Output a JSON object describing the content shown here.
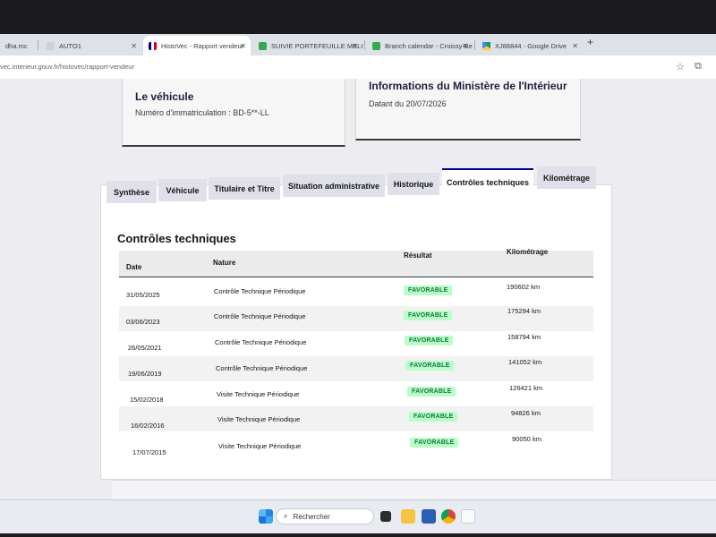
{
  "browser": {
    "tabs": [
      {
        "title": "dha.mc",
        "active": false
      },
      {
        "title": "AUTO1",
        "active": false
      },
      {
        "title": "HistoVec - Rapport vendeur",
        "active": true
      },
      {
        "title": "SUIVIE PORTEFEUILLE MELINA",
        "active": false
      },
      {
        "title": "Branch calendar - Croissy-Beau",
        "active": false
      },
      {
        "title": "XJ88844 - Google Drive",
        "active": false
      }
    ],
    "new_tab": "+",
    "url": "vec.interieur.gouv.fr/histovec/rapport-vendeur",
    "star_icon": "star-icon",
    "extensions_icon": "extensions-icon",
    "colors": {
      "tab_strip": "#dde1e8",
      "drive_green": "#0f9d58",
      "calendar_green": "#34a853"
    }
  },
  "vehicle_card": {
    "title": "Le véhicule",
    "plate_text": "Numéro d'immatriculation : BD-5**-LL"
  },
  "ministry_card": {
    "title": "Informations du Ministère de l'Intérieur",
    "date_text": "Datant du 20/07/2026"
  },
  "nav_tabs": [
    {
      "label": "Synthèse",
      "active": false
    },
    {
      "label": "Véhicule",
      "active": false
    },
    {
      "label": "Titulaire et Titre",
      "active": false
    },
    {
      "label": "Situation administrative",
      "active": false
    },
    {
      "label": "Historique",
      "active": false
    },
    {
      "label": "Contrôles techniques",
      "active": true
    },
    {
      "label": "Kilométrage",
      "active": false
    }
  ],
  "controls": {
    "title": "Contrôles techniques",
    "headers": {
      "date": "Date",
      "nature": "Nature",
      "result": "Résultat",
      "km": "Kilométrage"
    },
    "rows": [
      {
        "date": "31/05/2025",
        "nature": "Contrôle Technique Périodique",
        "result": "FAVORABLE",
        "km": "190602 km"
      },
      {
        "date": "03/06/2023",
        "nature": "Contrôle Technique Périodique",
        "result": "FAVORABLE",
        "km": "175294 km"
      },
      {
        "date": "26/05/2021",
        "nature": "Contrôle Technique Périodique",
        "result": "FAVORABLE",
        "km": "158794 km"
      },
      {
        "date": "19/06/2019",
        "nature": "Contrôle Technique Périodique",
        "result": "FAVORABLE",
        "km": "141052 km"
      },
      {
        "date": "15/02/2018",
        "nature": "Visite Technique Périodique",
        "result": "FAVORABLE",
        "km": "126421 km"
      },
      {
        "date": "16/02/2016",
        "nature": "Visite Technique Périodique",
        "result": "FAVORABLE",
        "km": "94826 km"
      },
      {
        "date": "17/07/2015",
        "nature": "Visite Technique Périodique",
        "result": "FAVORABLE",
        "km": "90050 km"
      }
    ],
    "colors": {
      "badge_bg": "#b8fec9",
      "badge_text": "#18753c",
      "active_tab_border": "#000091"
    }
  },
  "taskbar": {
    "search_placeholder": "Rechercher",
    "apps": [
      "windows-start-icon",
      "search-icon",
      "task-view-icon",
      "file-explorer-icon",
      "store-icon",
      "chrome-icon",
      "paint-icon"
    ]
  }
}
